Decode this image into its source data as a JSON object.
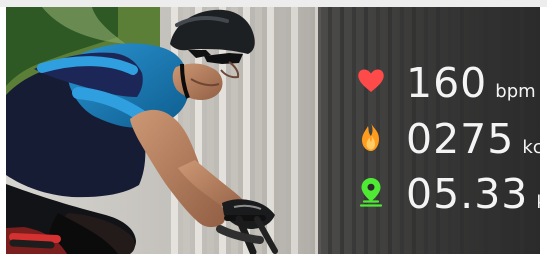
{
  "colors": {
    "heart": "#ff4a4a",
    "fire": "#ff9b1d",
    "pin": "#4eea34",
    "text": "#f4f4f4"
  },
  "stats": [
    {
      "icon": "heart-icon",
      "value": "160",
      "unit": "bpm"
    },
    {
      "icon": "fire-icon",
      "value": "0275",
      "unit": "kcal"
    },
    {
      "icon": "location-pin-icon",
      "value": "05.33",
      "unit": "km"
    }
  ]
}
